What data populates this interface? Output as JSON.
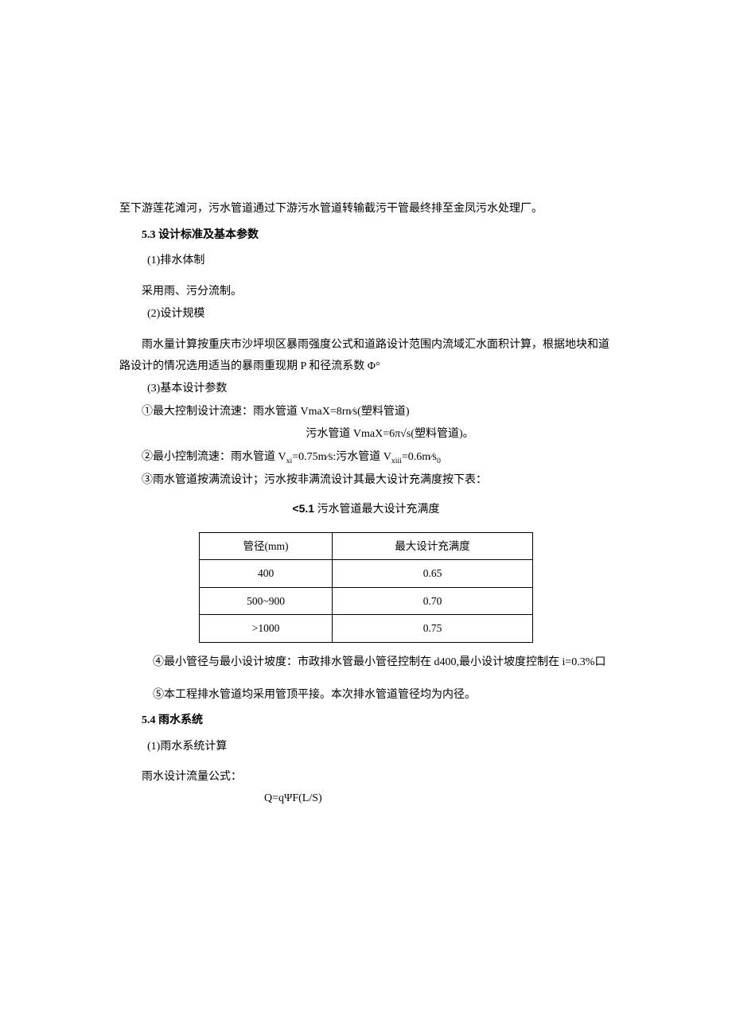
{
  "p1": "至下游莲花滩河，污水管道通过下游污水管道转输截污干管最终排至金凤污水处理厂。",
  "h53": {
    "num": "5.3",
    "title": " 设计标准及基本参数"
  },
  "i1": "(1)排水体制",
  "i1a": "采用雨、污分流制。",
  "i2": "(2)设计规模",
  "i2a": "雨水量计算按重庆市沙坪坝区暴雨强度公式和道路设计范围内流域汇水面积计算，根据地块和道路设计的情况选用适当的暴雨重现期 P 和径流系数 Φ°",
  "i3": "(3)基本设计参数",
  "c1": "①最大控制设计流速：雨水管道 VmaX=8rn⁄s(塑料管道)",
  "c1b": "污水管道 VmaX=6π√s(塑料管道)。",
  "c2p": "②最小控制流速：雨水管道 V",
  "c2s1": "xi",
  "c2m": "=0.75m⁄s:污水管道 V",
  "c2s2": "xiii",
  "c2e": "=0.6m⁄s",
  "c2f": "0",
  "c3": "③雨水管道按满流设计；污水按非满流设计其最大设计充满度按下表：",
  "caption": {
    "num": "<5.1",
    "title": " 污水管道最大设计充满度"
  },
  "th1": "管径(mm)",
  "th2": "最大设计充满度",
  "row1": {
    "a": "400",
    "b": "0.65"
  },
  "row2": {
    "a": "500~900",
    "b": "0.70"
  },
  "row3": {
    "a": ">1000",
    "b": "0.75"
  },
  "c4": "④最小管径与最小设计坡度：市政排水管最小管径控制在 d400,最小设计坡度控制在 i=0.3%口",
  "c5": "⑤本工程排水管道均采用管顶平接。本次排水管道管径均为内径。",
  "h54": {
    "num": "5.4",
    "title": " 雨水系统"
  },
  "s1": "(1)雨水系统计算",
  "s1a": "雨水设计流量公式：",
  "formula": "Q=qΨF(L/S)",
  "chart_data": {
    "type": "table",
    "title": "<5.1 污水管道最大设计充满度",
    "columns": [
      "管径(mm)",
      "最大设计充满度"
    ],
    "rows": [
      [
        "400",
        0.65
      ],
      [
        "500~900",
        0.7
      ],
      [
        ">1000",
        0.75
      ]
    ]
  }
}
